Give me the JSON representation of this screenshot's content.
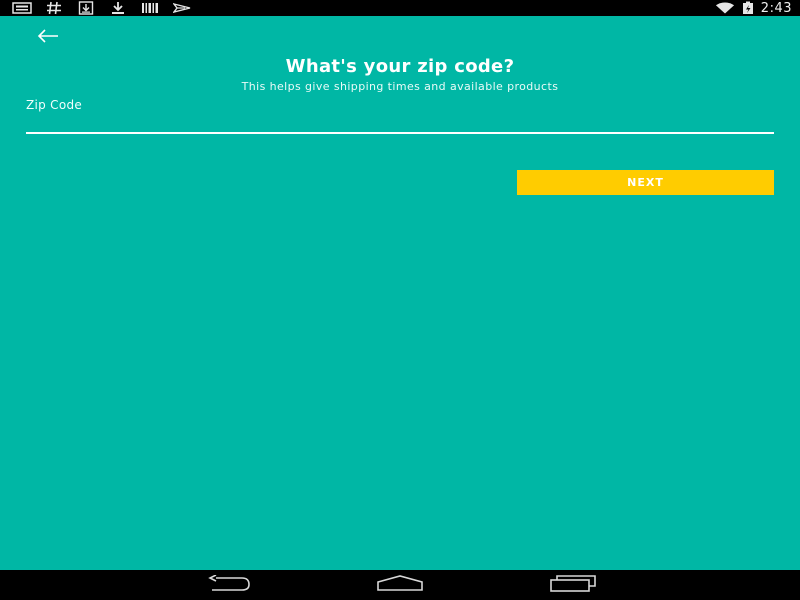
{
  "status_bar": {
    "icons": [
      "news-icon",
      "hash-icon",
      "download-box-icon",
      "download-icon",
      "barcode-icon",
      "send-icon"
    ],
    "right_icons": [
      "wifi-icon",
      "battery-charging-icon"
    ],
    "time": "2:43"
  },
  "header": {
    "back_icon": "arrow-left-icon",
    "title": "What's your zip code?",
    "subtitle": "This helps give shipping times and available products"
  },
  "form": {
    "zip_label": "Zip Code",
    "zip_value": "",
    "next_label": "NEXT"
  },
  "nav_bar": {
    "icons": [
      "nav-back-icon",
      "nav-home-icon",
      "nav-recents-icon"
    ]
  },
  "colors": {
    "background": "#00b7a5",
    "accent": "#ffcc00",
    "text": "#ffffff",
    "system_bar": "#000000"
  }
}
